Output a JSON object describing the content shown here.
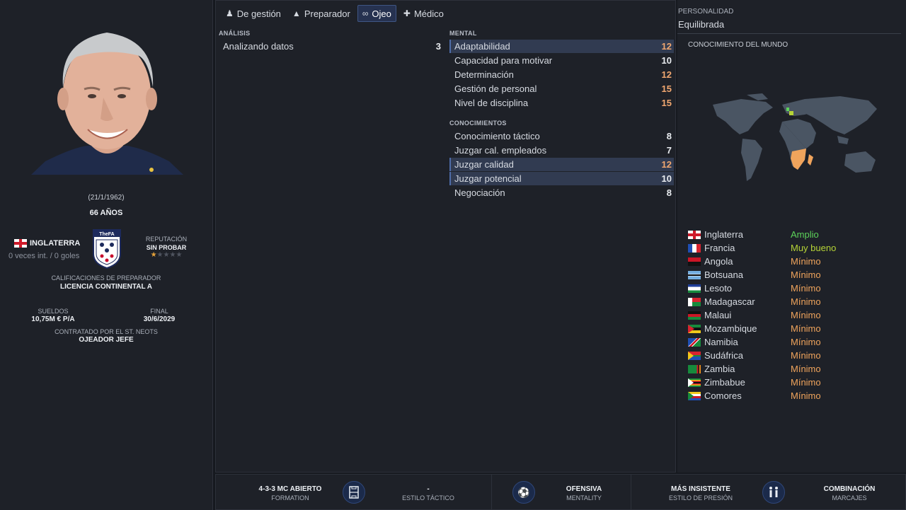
{
  "profile": {
    "birth_date": "(21/1/1962)",
    "age": "66 AÑOS",
    "nationality": "INGLATERRA",
    "caps": "0 veces int. / 0 goles",
    "crest_text": "TheFA",
    "reputation_label": "REPUTACIÓN",
    "reputation_value": "SIN PROBAR",
    "reputation_stars": 1,
    "qual_label": "CALIFICACIONES DE PREPARADOR",
    "qual_value": "LICENCIA CONTINENTAL A",
    "salary_label": "SUELDOS",
    "salary_value": "10,75M € P/A",
    "final_label": "FINAL",
    "final_value": "30/6/2029",
    "contract_label": "CONTRATADO POR EL ST. NEOTS",
    "contract_value": "OJEADOR JEFE"
  },
  "tabs": [
    {
      "label": "De gestión",
      "icon": "manager-icon"
    },
    {
      "label": "Preparador",
      "icon": "coach-icon"
    },
    {
      "label": "Ojeo",
      "icon": "binoculars-icon",
      "active": true
    },
    {
      "label": "Médico",
      "icon": "medical-kit-icon"
    }
  ],
  "analysis": {
    "title": "ANÁLISIS",
    "rows": [
      {
        "label": "Analizando datos",
        "value": "3"
      }
    ]
  },
  "mental": {
    "title": "MENTAL",
    "rows": [
      {
        "label": "Adaptabilidad",
        "value": "12",
        "highlight": true
      },
      {
        "label": "Capacidad para motivar",
        "value": "10"
      },
      {
        "label": "Determinación",
        "value": "12"
      },
      {
        "label": "Gestión de personal",
        "value": "15"
      },
      {
        "label": "Nivel de disciplina",
        "value": "15"
      }
    ]
  },
  "knowledge": {
    "title": "CONOCIMIENTOS",
    "rows": [
      {
        "label": "Conocimiento táctico",
        "value": "8"
      },
      {
        "label": "Juzgar cal. empleados",
        "value": "7"
      },
      {
        "label": "Juzgar calidad",
        "value": "12",
        "highlight": true
      },
      {
        "label": "Juzgar potencial",
        "value": "10",
        "highlight": true
      },
      {
        "label": "Negociación",
        "value": "8"
      }
    ]
  },
  "personality": {
    "label": "PERSONALIDAD",
    "value": "Equilibrada"
  },
  "world": {
    "title": "CONOCIMIENTO DEL MUNDO",
    "countries": [
      {
        "name": "Inglaterra",
        "level": "Amplio",
        "color": "#5dd35a"
      },
      {
        "name": "Francia",
        "level": "Muy bueno",
        "color": "#b5d336"
      },
      {
        "name": "Angola",
        "level": "Mínimo",
        "color": "#f0a45c"
      },
      {
        "name": "Botsuana",
        "level": "Mínimo",
        "color": "#f0a45c"
      },
      {
        "name": "Lesoto",
        "level": "Mínimo",
        "color": "#f0a45c"
      },
      {
        "name": "Madagascar",
        "level": "Mínimo",
        "color": "#f0a45c"
      },
      {
        "name": "Malaui",
        "level": "Mínimo",
        "color": "#f0a45c"
      },
      {
        "name": "Mozambique",
        "level": "Mínimo",
        "color": "#f0a45c"
      },
      {
        "name": "Namibia",
        "level": "Mínimo",
        "color": "#f0a45c"
      },
      {
        "name": "Sudáfrica",
        "level": "Mínimo",
        "color": "#f0a45c"
      },
      {
        "name": "Zambia",
        "level": "Mínimo",
        "color": "#f0a45c"
      },
      {
        "name": "Zimbabue",
        "level": "Mínimo",
        "color": "#f0a45c"
      },
      {
        "name": "Comores",
        "level": "Mínimo",
        "color": "#f0a45c"
      }
    ]
  },
  "bottom": {
    "formation": {
      "value": "4-3-3 MC ABIERTO",
      "label": "FORMATION"
    },
    "style": {
      "value": "-",
      "label": "ESTILO TÁCTICO"
    },
    "mentality": {
      "value": "OFENSIVA",
      "label": "MENTALITY"
    },
    "pressing": {
      "value": "MÁS INSISTENTE",
      "label": "ESTILO DE PRESIÓN"
    },
    "marking": {
      "value": "COMBINACIÓN",
      "label": "MARCAJES"
    }
  }
}
